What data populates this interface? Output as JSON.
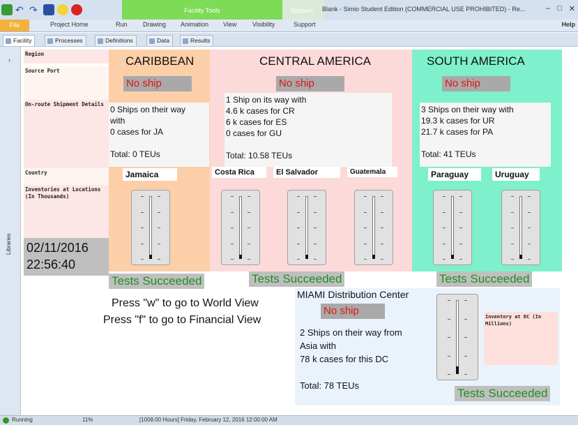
{
  "titlebar": {
    "context_tab": "Facility Tools",
    "context_tab2": "Support",
    "window_title": "Blank - Simio Student Edition (COMMERCIAL USE PROHIBITED) - Re..."
  },
  "ribbon": {
    "file_label": "File",
    "tabs": [
      "Project Home",
      "Run",
      "Drawing",
      "Animation",
      "View",
      "Visibility",
      "Support"
    ],
    "help_label": "Help"
  },
  "subtabs": [
    "Facility",
    "Processes",
    "Definitions",
    "Data",
    "Results"
  ],
  "left_strip": {
    "label": "Libraries"
  },
  "row_labels": {
    "region": "Region",
    "source_port": "Source Port",
    "onroute": "On-route Shipment Details",
    "country": "Country",
    "inventories": "Inventories at Locations (In Thousands)"
  },
  "datetime": {
    "date": "02/11/2016",
    "time": "22:56:40"
  },
  "regions": {
    "caribbean": {
      "title": "CARIBBEAN",
      "port_status": "No ship",
      "ship_lines": [
        "0 Ships on their way",
        "with",
        "0  cases for JA",
        "",
        "Total: 0 TEUs"
      ],
      "countries": [
        "Jamaica"
      ],
      "tests": "Tests Succeeded"
    },
    "central": {
      "title": "CENTRAL AMERICA",
      "port_status": "No ship",
      "ship_lines": [
        "1 Ship on its way with",
        "4.6 k cases for CR",
        "6 k cases for ES",
        "0  cases for GU",
        "",
        "Total: 10.58 TEUs"
      ],
      "countries": [
        "Costa Rica",
        "El Salvador",
        "Guatemala"
      ],
      "tests": "Tests Succeeded"
    },
    "south": {
      "title": "SOUTH AMERICA",
      "port_status": "No ship",
      "ship_lines": [
        "3 Ships on their way with",
        "19.3 k cases for UR",
        "21.7 k cases for PA",
        "",
        "Total: 41 TEUs"
      ],
      "countries": [
        "Paraguay",
        "Uruguay"
      ],
      "tests": "Tests Succeeded"
    }
  },
  "instructions": {
    "line1": "Press \"w\" to go to World View",
    "line2": "Press \"f\" to go to Financial View"
  },
  "miami": {
    "title": "MIAMI Distribution Center",
    "port_status": "No ship",
    "ship_lines": [
      "2 Ships on their way from",
      "Asia with",
      "78 k cases for this DC",
      "",
      "Total:  78 TEUs"
    ],
    "inventory_label": "Inventory at DC (In Millions)",
    "tests": "Tests Succeeded"
  },
  "gauge_levels": {
    "jamaica": 0.05,
    "costa_rica": 0.05,
    "el_salvador": 0.05,
    "guatemala": 0.03,
    "paraguay": 0.03,
    "uruguay": 0.05,
    "miami_dc": 0.1
  },
  "status": {
    "state": "Running",
    "speed": "11%",
    "sim_time": "[1008.00 Hours] Friday, February 12, 2016 12:00:00 AM"
  },
  "colors": {
    "caribbean_bg": "#fccfa8",
    "central_bg": "#fcdada",
    "south_bg": "#7ef0cb",
    "miami_bg": "#eaf3fb",
    "no_ship_text": "#e01515",
    "tests_text": "#1f8f1f"
  }
}
